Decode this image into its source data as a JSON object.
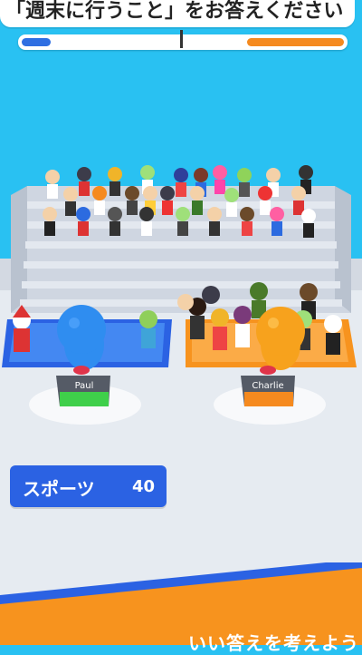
{
  "question": {
    "text": "「週末に行うこと」をお答えください"
  },
  "scoreboard": {
    "left_fraction": 0.09,
    "right_fraction": 0.3,
    "left_color": "#2f6fe2",
    "right_color": "#f58a1f"
  },
  "players": {
    "left_name": "Paul",
    "right_name": "Charlie",
    "left_color": "#2f8df0",
    "right_color": "#f7a21d"
  },
  "category": {
    "label": "スポーツ",
    "count": "40"
  },
  "hint": {
    "text": "いい答えを考えよう"
  },
  "colors": {
    "background": "#29c1f2",
    "stands": "#d8dde6",
    "floor": "#e9edf2",
    "bottom_band": "#f7931e",
    "bottom_stripe": "#2b62e3"
  }
}
